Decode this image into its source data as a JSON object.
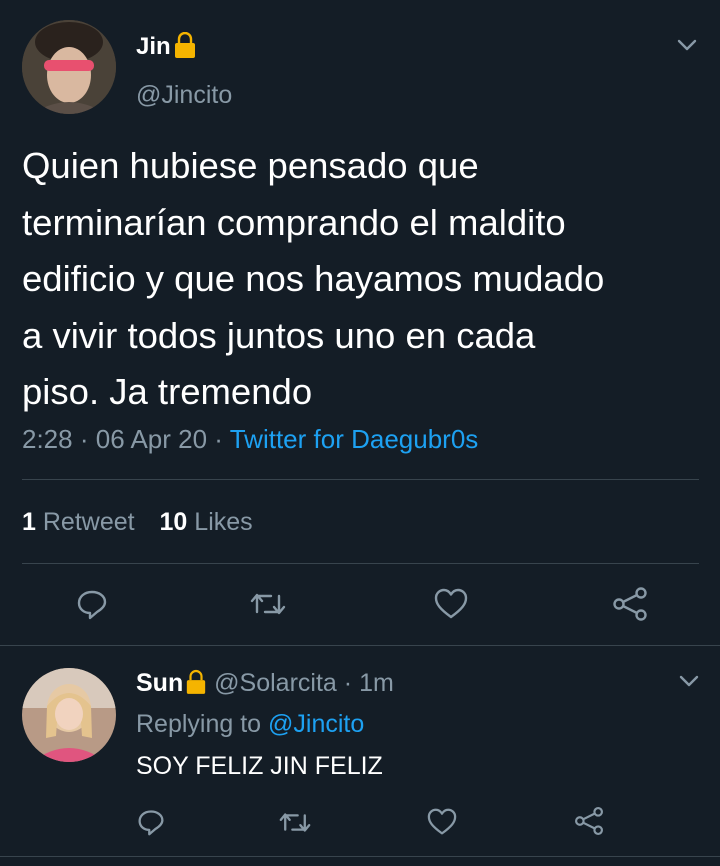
{
  "tweet": {
    "display_name": "Jin",
    "handle": "@Jincito",
    "text_lines": [
      "Quien hubiese pensado que",
      "terminarían comprando el maldito",
      "edificio y que nos hayamos mudado",
      "a vivir todos juntos uno en cada",
      "piso. Ja tremendo"
    ],
    "time": "2:28",
    "sep": "·",
    "date": "06 Apr 20",
    "source": "Twitter for Daegubr0s",
    "retweet_count": "1",
    "retweet_label": "Retweet",
    "like_count": "10",
    "like_label": "Likes"
  },
  "reply": {
    "display_name": "Sun",
    "handle": "@Solarcita",
    "age": "1m",
    "replying_prefix": "Replying to",
    "replying_handle": "@Jincito",
    "text": "SOY FELIZ JIN FELIZ"
  },
  "colors": {
    "background": "#141d26",
    "muted": "#8899a6",
    "accent": "#1da1f2",
    "lock": "#f5b400"
  },
  "icons": [
    "chevron-down-icon",
    "lock-icon",
    "reply-icon",
    "retweet-icon",
    "like-icon",
    "share-icon"
  ]
}
